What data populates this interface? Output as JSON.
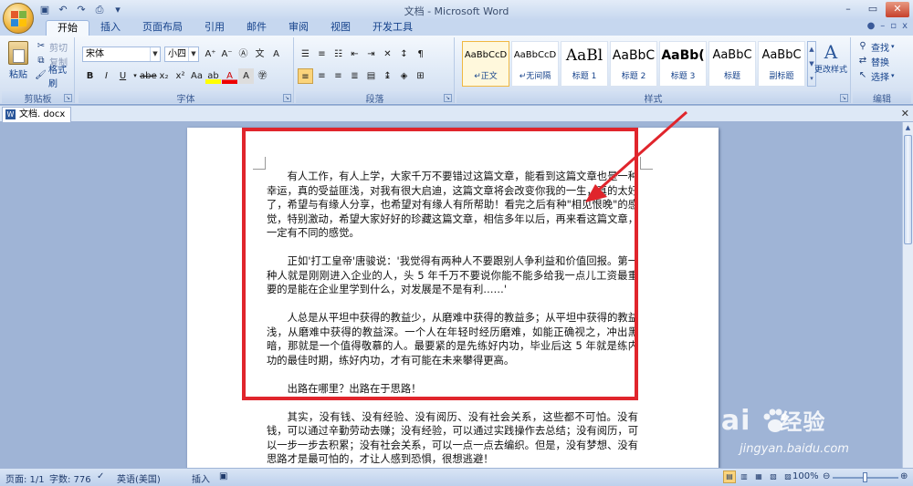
{
  "window": {
    "title": "文档 - Microsoft Word",
    "minimize_label": "–",
    "restore_label": "▭",
    "close_label": "✕"
  },
  "quick_access": [
    "save-icon",
    "undo-icon",
    "redo-icon",
    "print-preview-icon",
    "customize-icon"
  ],
  "ribbon_tabs": [
    "开始",
    "插入",
    "页面布局",
    "引用",
    "邮件",
    "审阅",
    "视图",
    "开发工具"
  ],
  "active_tab": "开始",
  "clipboard": {
    "paste_label": "粘贴",
    "cut_label": "剪切",
    "copy_label": "复制",
    "format_painter_label": "格式刷",
    "group_label": "剪贴板"
  },
  "font": {
    "font_name": "宋体",
    "font_size": "小四",
    "group_label": "字体"
  },
  "paragraph": {
    "group_label": "段落"
  },
  "styles": {
    "group_label": "样式",
    "items": [
      {
        "sample": "AaBbCcD",
        "name": "↵正文"
      },
      {
        "sample": "AaBbCcD",
        "name": "↵无间隔"
      },
      {
        "sample": "AaBl",
        "name": "标题 1"
      },
      {
        "sample": "AaBbC",
        "name": "标题 2"
      },
      {
        "sample": "AaBb(",
        "name": "标题 3"
      },
      {
        "sample": "AaBbC",
        "name": "标题"
      },
      {
        "sample": "AaBbC",
        "name": "副标题"
      }
    ],
    "change_styles_label": "更改样式"
  },
  "editing": {
    "find_label": "查找",
    "replace_label": "替换",
    "select_label": "选择",
    "group_label": "编辑"
  },
  "document_tab": {
    "name": "文档. docx"
  },
  "document": {
    "paragraphs": [
      "有人工作，有人上学，大家千万不要错过这篇文章，能看到这篇文章也是一种幸运，真的受益匪浅，对我有很大启迪，这篇文章将会改变你我的一生，真的太好了，希望与有缘人分享，也希望对有缘人有所帮助！看完之后有种\"相见恨晚\"的感觉，特别激动，希望大家好好的珍藏这篇文章，相信多年以后，再来看这篇文章，一定有不同的感觉。",
      "正如'打工皇帝'唐骏说：'我觉得有两种人不要跟别人争利益和价值回报。第一种人就是刚刚进入企业的人，头 5 年千万不要说你能不能多给我一点儿工资最重要的是能在企业里学到什么，对发展是不是有利……'",
      "人总是从平坦中获得的教益少，从磨难中获得的教益多；从平坦中获得的教益浅，从磨难中获得的教益深。一个人在年轻时经历磨难，如能正确视之，冲出黑暗，那就是一个值得敬慕的人。最要紧的是先练好内功，毕业后这 5 年就是练内功的最佳时期，练好内功，才有可能在未来攀得更高。",
      "出路在哪里？出路在于思路！",
      "其实，没有钱、没有经验、没有阅历、没有社会关系，这些都不可怕。没有钱，可以通过辛勤劳动去赚；没有经验，可以通过实践操作去总结；没有阅历，可以一步一步去积累；没有社会关系，可以一点一点去编织。但是，没有梦想、没有思路才是最可怕的，才让人感到恐惧，很想逃避！"
    ]
  },
  "watermark": {
    "main": "Bai",
    "main2": "经验",
    "sub": "jingyan.baidu.com"
  },
  "statusbar": {
    "page": "页面: 1/1",
    "words": "字数: 776",
    "language": "英语(美国)",
    "mode": "插入",
    "zoom": "100%",
    "zoom_fraction": 0.5
  },
  "colors": {
    "highlight_box": "#e0252c",
    "ribbon_bg": "#dde8f6"
  }
}
